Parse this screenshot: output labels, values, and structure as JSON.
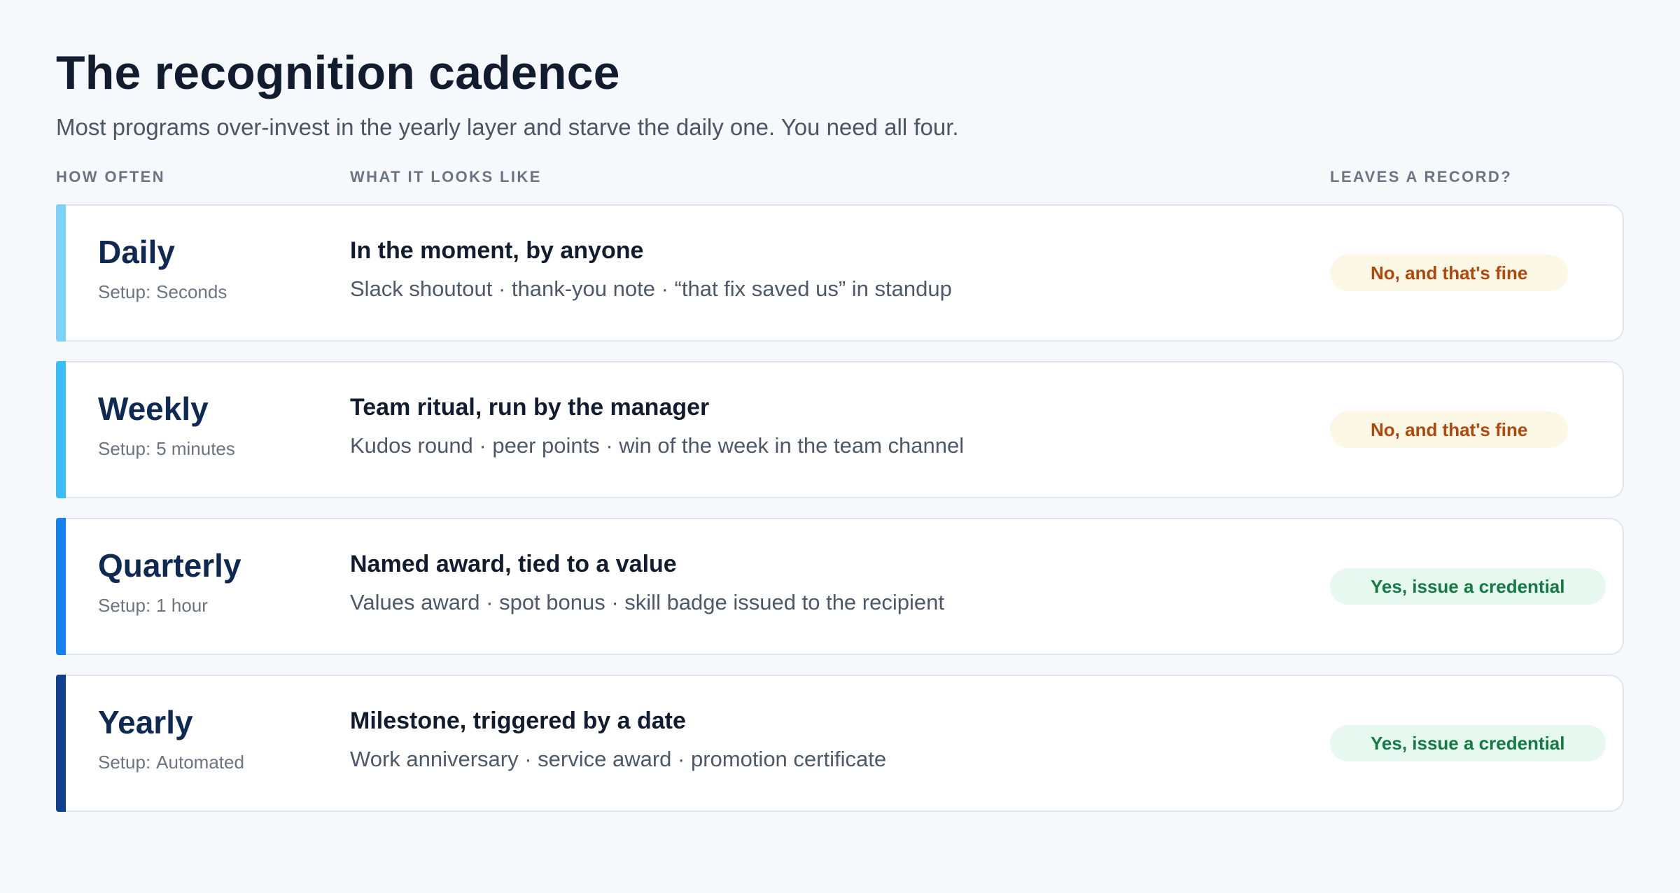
{
  "header": {
    "title": "The recognition cadence",
    "subtitle": "Most programs over-invest in the yearly layer and starve the daily one. You need all four."
  },
  "columns": {
    "how_often": "HOW OFTEN",
    "what_it_looks_like": "WHAT IT LOOKS LIKE",
    "leaves_a_record": "LEAVES A RECORD?"
  },
  "setup_label": "Setup:",
  "rows": [
    {
      "frequency": "Daily",
      "setup": "Seconds",
      "title": "In the moment, by anyone",
      "examples": "Slack shoutout · thank-you note · “that fix saved us” in standup",
      "record": "No, and that's fine",
      "record_kind": "no",
      "accent_color": "#7dd3f7"
    },
    {
      "frequency": "Weekly",
      "setup": "5 minutes",
      "title": "Team ritual, run by the manager",
      "examples": "Kudos round · peer points · win of the week in the team channel",
      "record": "No, and that's fine",
      "record_kind": "no",
      "accent_color": "#38bdf8"
    },
    {
      "frequency": "Quarterly",
      "setup": "1 hour",
      "title": "Named award, tied to a value",
      "examples": "Values award · spot bonus · skill badge issued to the recipient",
      "record": "Yes, issue a credential",
      "record_kind": "yes",
      "accent_color": "#1483f0"
    },
    {
      "frequency": "Yearly",
      "setup": "Automated",
      "title": "Milestone, triggered by a date",
      "examples": "Work anniversary · service award · promotion certificate",
      "record": "Yes, issue a credential",
      "record_kind": "yes",
      "accent_color": "#103f8f"
    }
  ]
}
